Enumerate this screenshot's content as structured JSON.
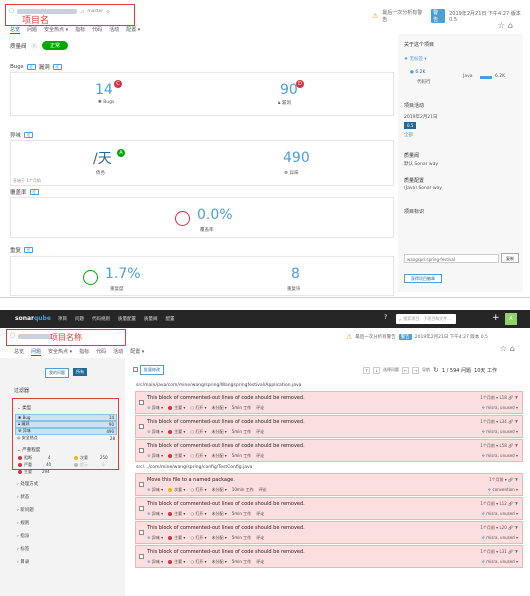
{
  "overview": {
    "project_name": "项目名",
    "branch": "master",
    "tabs": [
      "总览",
      "问题",
      "安全热点 ▾",
      "指标",
      "代码",
      "活动",
      "配置 ▾"
    ],
    "active_tab": "总览",
    "warning": "最后一次分析有警告",
    "warning_badge": "警告",
    "analysis_time": "2019年2月21日 下午4:27  版本 0.5",
    "quality_gate_label": "质量阀",
    "quality_gate_status": "正常",
    "bugs_section": "Bugs",
    "vuln_section": "漏洞",
    "bugs_value": "14",
    "bugs_rating": "C",
    "bugs_label": "Bugs",
    "vuln_value": "90",
    "vuln_rating": "D",
    "vuln_label": "漏洞",
    "smell_section": "异味",
    "debt_value": "/天",
    "debt_rating": "A",
    "debt_label": "债务",
    "debt_note": "开始于 1个月前",
    "smell_value": "490",
    "smell_label": "异味",
    "coverage_section": "覆盖率",
    "coverage_value": "0.0%",
    "coverage_label": "覆盖率",
    "dup_section": "重复",
    "dup_value": "1.7%",
    "dup_label": "重复度",
    "dup_blocks_value": "8",
    "dup_blocks_label": "重复块",
    "right": {
      "about_title": "关于这个项目",
      "tag_label": "无标签 ▾",
      "lines_value": "6.2K",
      "lines_label": "代码行",
      "lang_label": "Java",
      "lang_value": "6.2K",
      "activity_title": "项目活动",
      "activity_date": "2019年2月21日",
      "activity_badge": "0.5",
      "activity_more": "全部",
      "gate_title": "质量阀",
      "gate_value": "默认  Sonar way",
      "profile_title": "质量配置",
      "profile_value": "(Java) Sonar way",
      "key_title": "项目标识",
      "key_value": "wangspri:spring-festival",
      "copy_label": "复制",
      "download_label": "获得项目徽章"
    }
  },
  "issues": {
    "logo_text": "sonar",
    "logo_q": "qube",
    "topnav": [
      "项目",
      "问题",
      "代码规则",
      "质量配置",
      "质量阀",
      "配置"
    ],
    "search_placeholder": "搜索项目、子项目和文件...",
    "avatar_letter": "A",
    "project_name": "项目名称",
    "warning": "最后一次分析有警告",
    "warning_badge": "警告",
    "analysis_time": "2019年2月21日 下午4:27  版本 0.5",
    "tabs": [
      "总览",
      "问题",
      "安全热点 ▾",
      "指标",
      "代码",
      "活动",
      "配置 ▾"
    ],
    "active_tab": "问题",
    "my_issues": "我的问题",
    "all_issues": "所有",
    "filters_label": "过滤器",
    "type_label": "类型",
    "types": [
      {
        "name": "Bug",
        "count": "14"
      },
      {
        "name": "漏洞",
        "count": "90"
      },
      {
        "name": "异味",
        "count": "490"
      },
      {
        "name": "安全热点",
        "count": "28"
      }
    ],
    "severity_label": "严重程度",
    "severities": [
      {
        "name": "阻断",
        "count": "4",
        "color": "#d4333f"
      },
      {
        "name": "次要",
        "count": "250",
        "color": "#eabe06"
      },
      {
        "name": "严重",
        "count": "40",
        "color": "#d4333f"
      },
      {
        "name": "提示",
        "count": "0",
        "color": "#bbbbbb"
      },
      {
        "name": "主要",
        "count": "294",
        "color": "#d4333f"
      }
    ],
    "collapsed_facets": [
      "处理方式",
      "状态",
      "新问题",
      "规则",
      "指派",
      "标签",
      "目录"
    ],
    "bulk_change": "批量修改",
    "select_issues": "选择问题",
    "navigate": "导航",
    "count_text": "1 / 594 问题",
    "effort_text": "10天 工作",
    "path1": "src/main/java/com/mine/wang/spring/Wangspringfestival/Application.java",
    "path2": "src/.../com/mine/wang/spring/config/TestConfig.java",
    "issue_list": [
      {
        "title": "This block of commented-out lines of code should be removed.",
        "type": "异味",
        "severity": "主要",
        "status": "打开",
        "assignee": "未分配",
        "effort": "5min 工作",
        "comment": "评论",
        "when": "1个月前",
        "line": "L18",
        "tags": "misra, unused"
      },
      {
        "title": "This block of commented-out lines of code should be removed.",
        "type": "异味",
        "severity": "主要",
        "status": "打开",
        "assignee": "未分配",
        "effort": "5min 工作",
        "comment": "评论",
        "when": "1个月前",
        "line": "L34",
        "tags": "misra, unused"
      },
      {
        "title": "This block of commented-out lines of code should be removed.",
        "type": "异味",
        "severity": "主要",
        "status": "打开",
        "assignee": "未分配",
        "effort": "5min 工作",
        "comment": "评论",
        "when": "1个月前",
        "line": "L58",
        "tags": "misra, unused"
      },
      {
        "title": "Move this file to a named package.",
        "type": "异味",
        "severity": "次要",
        "status": "打开",
        "assignee": "未分配",
        "effort": "10min 工作",
        "comment": "评论",
        "when": "1个月前",
        "line": "",
        "tags": "convention"
      },
      {
        "title": "This block of commented-out lines of code should be removed.",
        "type": "异味",
        "severity": "主要",
        "status": "打开",
        "assignee": "未分配",
        "effort": "5min 工作",
        "comment": "评论",
        "when": "1个月前",
        "line": "L12",
        "tags": "misra, unused"
      },
      {
        "title": "This block of commented-out lines of code should be removed.",
        "type": "异味",
        "severity": "主要",
        "status": "打开",
        "assignee": "未分配",
        "effort": "5min 工作",
        "comment": "评论",
        "when": "1个月前",
        "line": "L20",
        "tags": "misra, unused"
      },
      {
        "title": "This block of commented-out lines of code should be removed.",
        "type": "异味",
        "severity": "主要",
        "status": "打开",
        "assignee": "未分配",
        "effort": "5min 工作",
        "comment": "评论",
        "when": "1个月前",
        "line": "L31",
        "tags": "misra, unused"
      }
    ]
  }
}
